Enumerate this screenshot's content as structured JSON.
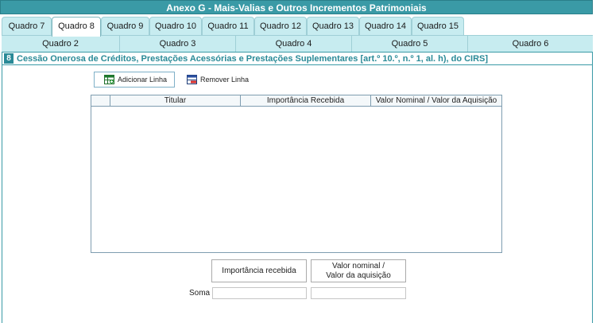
{
  "window_title": "Anexo G - Mais-Valias e Outros Incrementos Patrimoniais",
  "tabs_row1": [
    "Quadro 7",
    "Quadro 8",
    "Quadro 9",
    "Quadro 10",
    "Quadro 11",
    "Quadro 12",
    "Quadro 13",
    "Quadro 14",
    "Quadro 15"
  ],
  "active_tab": "Quadro 8",
  "tabs_row2": [
    "Quadro 2",
    "Quadro 3",
    "Quadro 4",
    "Quadro 5",
    "Quadro 6"
  ],
  "section": {
    "number": "8",
    "title": "Cessão Onerosa de Créditos, Prestações Acessórias e Prestações Suplementares [art.º 10.º, n.º 1, al. h), do CIRS]"
  },
  "toolbar": {
    "add_label": "Adicionar Linha",
    "remove_label": "Remover Linha"
  },
  "table": {
    "columns": [
      "",
      "Titular",
      "Importância Recebida",
      "Valor Nominal / Valor da Aquisição"
    ],
    "rows": []
  },
  "totals": {
    "col1_label": "Importância recebida",
    "col2_label_line1": "Valor nominal /",
    "col2_label_line2": "Valor da aquisição",
    "soma_label": "Soma",
    "col1_value": "",
    "col2_value": ""
  }
}
